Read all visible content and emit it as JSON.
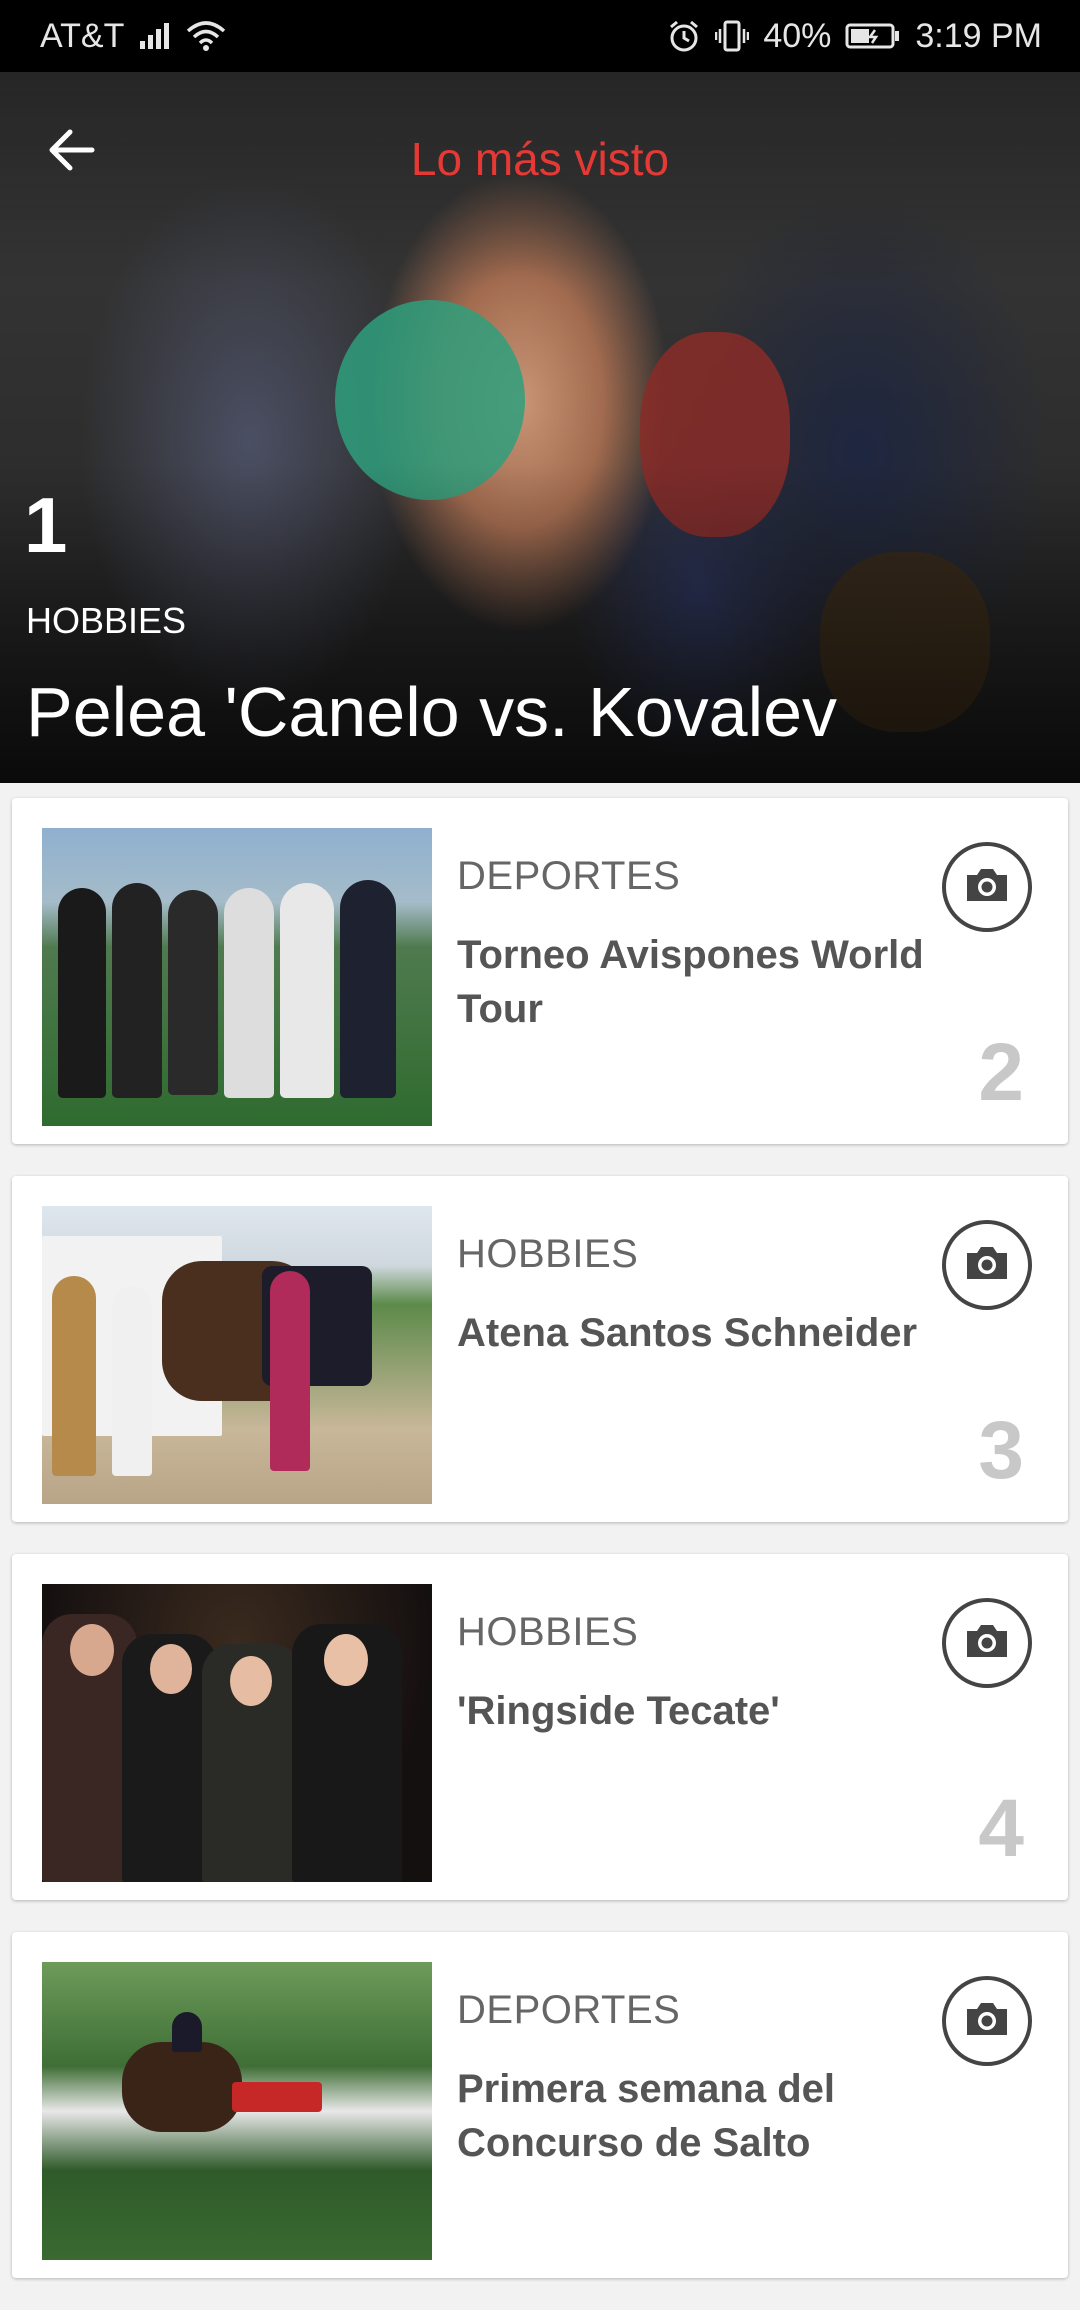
{
  "status_bar": {
    "carrier": "AT&T",
    "battery": "40%",
    "time": "3:19 PM"
  },
  "header": {
    "title": "Lo más visto"
  },
  "featured": {
    "rank": "1",
    "category": "HOBBIES",
    "headline": "Pelea 'Canelo vs. Kovalev"
  },
  "items": [
    {
      "category": "DEPORTES",
      "title": "Torneo Avispones World Tour",
      "rank": "2"
    },
    {
      "category": "HOBBIES",
      "title": "Atena Santos Schneider",
      "rank": "3"
    },
    {
      "category": "HOBBIES",
      "title": "'Ringside Tecate'",
      "rank": "4"
    },
    {
      "category": "DEPORTES",
      "title": "Primera semana del Concurso de Salto",
      "rank": ""
    }
  ],
  "colors": {
    "accent": "#e53935",
    "status_bar": "#000000",
    "rank_number": "#c8c8c8"
  },
  "icons": {
    "back": "arrow-left-icon",
    "gallery": "camera-icon"
  }
}
